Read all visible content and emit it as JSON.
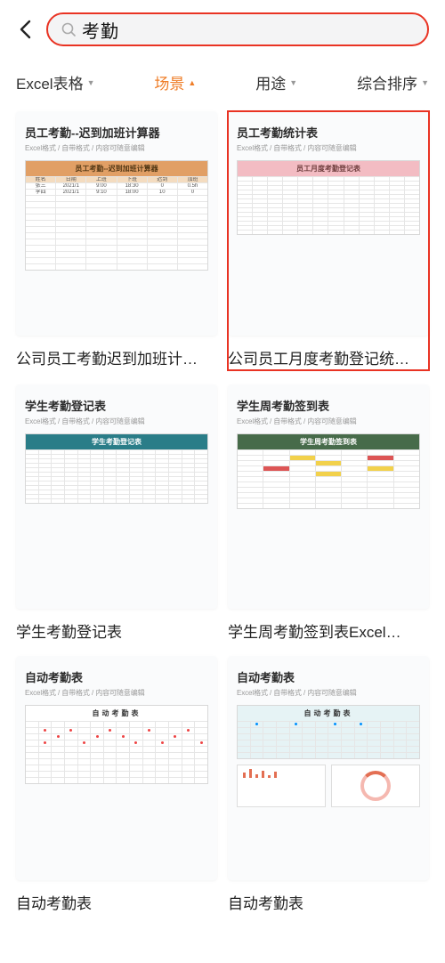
{
  "header": {
    "search_value": "考勤"
  },
  "filters": [
    {
      "label": "Excel表格",
      "active": false,
      "dir": "down"
    },
    {
      "label": "场景",
      "active": true,
      "dir": "up"
    },
    {
      "label": "用途",
      "active": false,
      "dir": "down"
    },
    {
      "label": "综合排序",
      "active": false,
      "dir": "down"
    }
  ],
  "cards": [
    {
      "thumb_title": "员工考勤--迟到加班计算器",
      "thumb_sub": "Excel格式 / 自带格式 / 内容可随意编辑",
      "title": "公司员工考勤迟到加班计…",
      "theme": "orange",
      "sheet_header": "员工考勤--迟到加班计算器"
    },
    {
      "thumb_title": "员工考勤统计表",
      "thumb_sub": "Excel格式 / 自带格式 / 内容可随意编辑",
      "title": "公司员工月度考勤登记统…",
      "theme": "pink",
      "sheet_header": "员工月度考勤登记表",
      "highlighted": true
    },
    {
      "thumb_title": "学生考勤登记表",
      "thumb_sub": "Excel格式 / 自带格式 / 内容可随意编辑",
      "title": "学生考勤登记表",
      "theme": "teal",
      "sheet_header": "学生考勤登记表"
    },
    {
      "thumb_title": "学生周考勤签到表",
      "thumb_sub": "Excel格式 / 自带格式 / 内容可随意编辑",
      "title": "学生周考勤签到表Excel…",
      "theme": "green",
      "sheet_header": "学生周考勤签到表"
    },
    {
      "thumb_title": "自动考勤表",
      "thumb_sub": "Excel格式 / 自带格式 / 内容可随意编辑",
      "title": "自动考勤表",
      "theme": "red",
      "sheet_header": "自动考勤表"
    },
    {
      "thumb_title": "自动考勤表",
      "thumb_sub": "Excel格式 / 自带格式 / 内容可随意编辑",
      "title": "自动考勤表",
      "theme": "charts",
      "sheet_header": "自动考勤表"
    }
  ]
}
